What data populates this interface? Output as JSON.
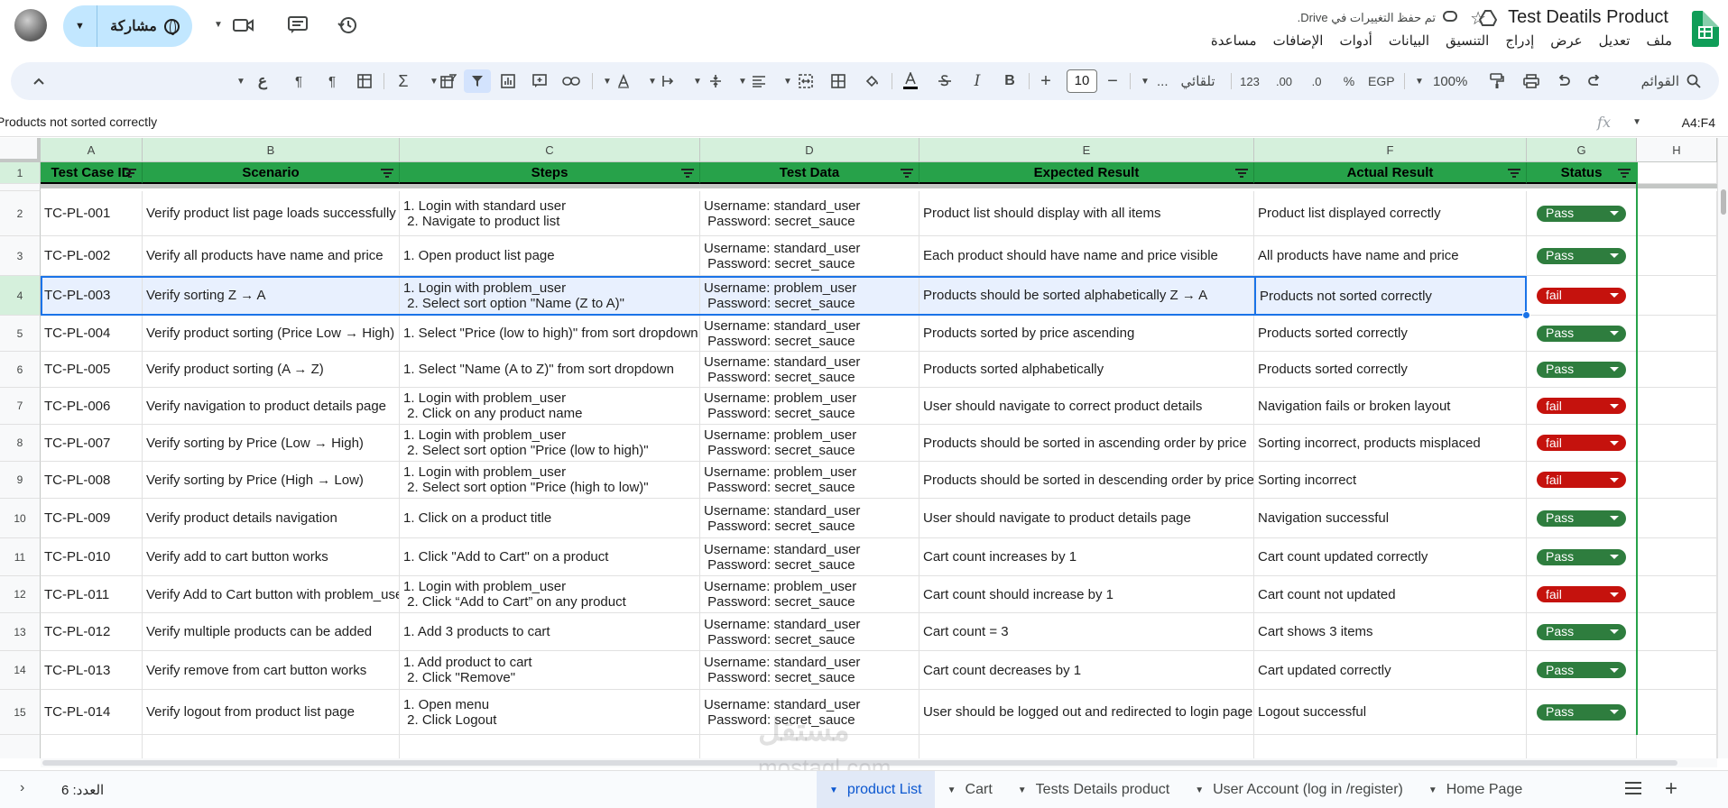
{
  "header": {
    "doc_title": "Test Deatils Product",
    "saved_status": "تم حفظ التغييرات في Drive.",
    "share_label": "مشاركة",
    "menu": [
      "ملف",
      "تعديل",
      "عرض",
      "إدراج",
      "التنسيق",
      "البيانات",
      "أدوات",
      "الإضافات",
      "مساعدة"
    ]
  },
  "toolbar": {
    "search_label": "القوائم",
    "zoom": "100%",
    "currency": "EGP",
    "percent": "%",
    "decimal_less": ".0",
    "decimal_more": ".00",
    "number_format": "123",
    "font_name": "تلقائي",
    "font_name_more": "...",
    "font_size": "10"
  },
  "formula_bar": {
    "name_box": "A4:F4",
    "fx": "fx",
    "content": "Products not sorted correctly"
  },
  "columns": [
    "A",
    "B",
    "C",
    "D",
    "E",
    "F",
    "G",
    "H"
  ],
  "table_headers": [
    "Test Case ID",
    "Scenario",
    "Steps",
    "Test Data",
    "Expected Result",
    "Actual Result",
    "Status"
  ],
  "rows": [
    {
      "num": "1"
    },
    {
      "num": "2",
      "id": "TC-PL-001",
      "scenario": "Verify product list page loads successfully",
      "steps": "1. Login with standard user\n 2. Navigate to product list",
      "data": "Username: standard_user\n Password: secret_sauce",
      "expected": "Product list should display with all items",
      "actual": "Product list displayed correctly",
      "status": "Pass"
    },
    {
      "num": "3",
      "id": "TC-PL-002",
      "scenario": "Verify all products have name and price",
      "steps": "1. Open product list page",
      "data": "Username: standard_user\n Password: secret_sauce",
      "expected": "Each product should have name and price visible",
      "actual": "All products have name and price",
      "status": "Pass"
    },
    {
      "num": "4",
      "id": "TC-PL-003",
      "scenario": " Verify sorting Z → A",
      "steps": "1. Login with problem_user\n 2. Select sort option \"Name (Z to A)\"",
      "data": "Username: problem_user\n Password: secret_sauce",
      "expected": "Products should be sorted alphabetically Z → A",
      "actual": "Products not sorted correctly",
      "status": "fail"
    },
    {
      "num": "5",
      "id": "TC-PL-004",
      "scenario": "Verify product sorting (Price Low → High)",
      "steps": "1. Select \"Price (low to high)\" from sort dropdown",
      "data": "Username: standard_user\n Password: secret_sauce",
      "expected": "Products sorted by price ascending",
      "actual": "Products sorted correctly",
      "status": "Pass"
    },
    {
      "num": "6",
      "id": "TC-PL-005",
      "scenario": "Verify product sorting (A → Z)",
      "steps": "1. Select \"Name (A to Z)\" from sort dropdown",
      "data": "Username: standard_user\n Password: secret_sauce",
      "expected": "Products sorted alphabetically",
      "actual": "Products sorted correctly",
      "status": "Pass"
    },
    {
      "num": "7",
      "id": "TC-PL-006",
      "scenario": "Verify navigation to product details page",
      "steps": "1. Login with problem_user\n 2. Click on any product name",
      "data": "Username: problem_user\n Password: secret_sauce",
      "expected": "User should navigate to correct product details",
      "actual": "Navigation fails or broken layout",
      "status": "fail"
    },
    {
      "num": "8",
      "id": "TC-PL-007",
      "scenario": " Verify sorting by Price (Low → High)",
      "steps": "1. Login with problem_user\n 2. Select sort option \"Price (low to high)\"",
      "data": "Username: problem_user\n Password: secret_sauce",
      "expected": "Products should be sorted in ascending order by price",
      "actual": "Sorting incorrect, products misplaced",
      "status": "fail"
    },
    {
      "num": "9",
      "id": "TC-PL-008",
      "scenario": "Verify sorting by Price (High → Low)",
      "steps": "1. Login with problem_user\n 2. Select sort option \"Price (high to low)\"",
      "data": "Username: problem_user\n Password: secret_sauce",
      "expected": "Products should be sorted in descending order by price",
      "actual": "Sorting incorrect",
      "status": "fail"
    },
    {
      "num": "10",
      "id": "TC-PL-009",
      "scenario": "Verify product details navigation",
      "steps": "1. Click on a product title",
      "data": "Username: standard_user\n Password: secret_sauce",
      "expected": "User should navigate to product details page",
      "actual": "Navigation successful",
      "status": "Pass"
    },
    {
      "num": "11",
      "id": "TC-PL-010",
      "scenario": "Verify add to cart button works",
      "steps": "1. Click \"Add to Cart\" on a product",
      "data": "Username: standard_user\n Password: secret_sauce",
      "expected": "Cart count increases by 1",
      "actual": "Cart count updated correctly",
      "status": "Pass"
    },
    {
      "num": "12",
      "id": "TC-PL-011",
      "scenario": "Verify Add to Cart button with problem_user",
      "steps": "1. Login with problem_user\n 2. Click “Add to Cart” on any product",
      "data": "Username: problem_user\n Password: secret_sauce",
      "expected": "Cart count should increase by 1",
      "actual": "Cart count not updated",
      "status": "fail"
    },
    {
      "num": "13",
      "id": "TC-PL-012",
      "scenario": "Verify multiple products can be added",
      "steps": "1. Add 3 products to cart",
      "data": "Username: standard_user\n Password: secret_sauce",
      "expected": "Cart count = 3",
      "actual": "Cart shows 3 items",
      "status": "Pass"
    },
    {
      "num": "14",
      "id": "TC-PL-013",
      "scenario": "Verify remove from cart button works",
      "steps": "1. Add product to cart\n 2. Click \"Remove\"",
      "data": "Username: standard_user\n Password: secret_sauce",
      "expected": "Cart count decreases by 1",
      "actual": "Cart updated correctly",
      "status": "Pass"
    },
    {
      "num": "15",
      "id": "TC-PL-014",
      "scenario": "Verify logout from product list page",
      "steps": "1. Open menu\n 2. Click Logout",
      "data": "Username: standard_user\n Password: secret_sauce",
      "expected": "User should be logged out and redirected to login page",
      "actual": "Logout successful",
      "status": "Pass"
    }
  ],
  "status_colors": {
    "Pass": "#2e7d3e",
    "fail": "#c5120d"
  },
  "bottom": {
    "count": "العدد: 6",
    "tabs": [
      "product List",
      "Cart",
      "Tests Details product",
      "User Account (log in /register)",
      "Home Page"
    ],
    "active_tab": "product List"
  },
  "watermark": {
    "line1": "مستقل",
    "line2": "mostaql.com"
  },
  "icons": [
    "sheets-logo-icon",
    "star-icon",
    "cloud-saved-icon",
    "drive-icon",
    "history-icon",
    "comment-icon",
    "video-icon",
    "globe-icon",
    "search-icon",
    "undo-icon",
    "redo-icon",
    "print-icon",
    "paint-format-icon",
    "bold-icon",
    "italic-icon",
    "strikethrough-icon",
    "text-color-icon",
    "fill-color-icon",
    "borders-icon",
    "merge-icon",
    "align-icon",
    "valign-icon",
    "wrap-icon",
    "rotate-icon",
    "link-icon",
    "comment-add-icon",
    "chart-icon",
    "filter-icon",
    "filter-views-icon",
    "functions-icon",
    "fx-icon"
  ]
}
